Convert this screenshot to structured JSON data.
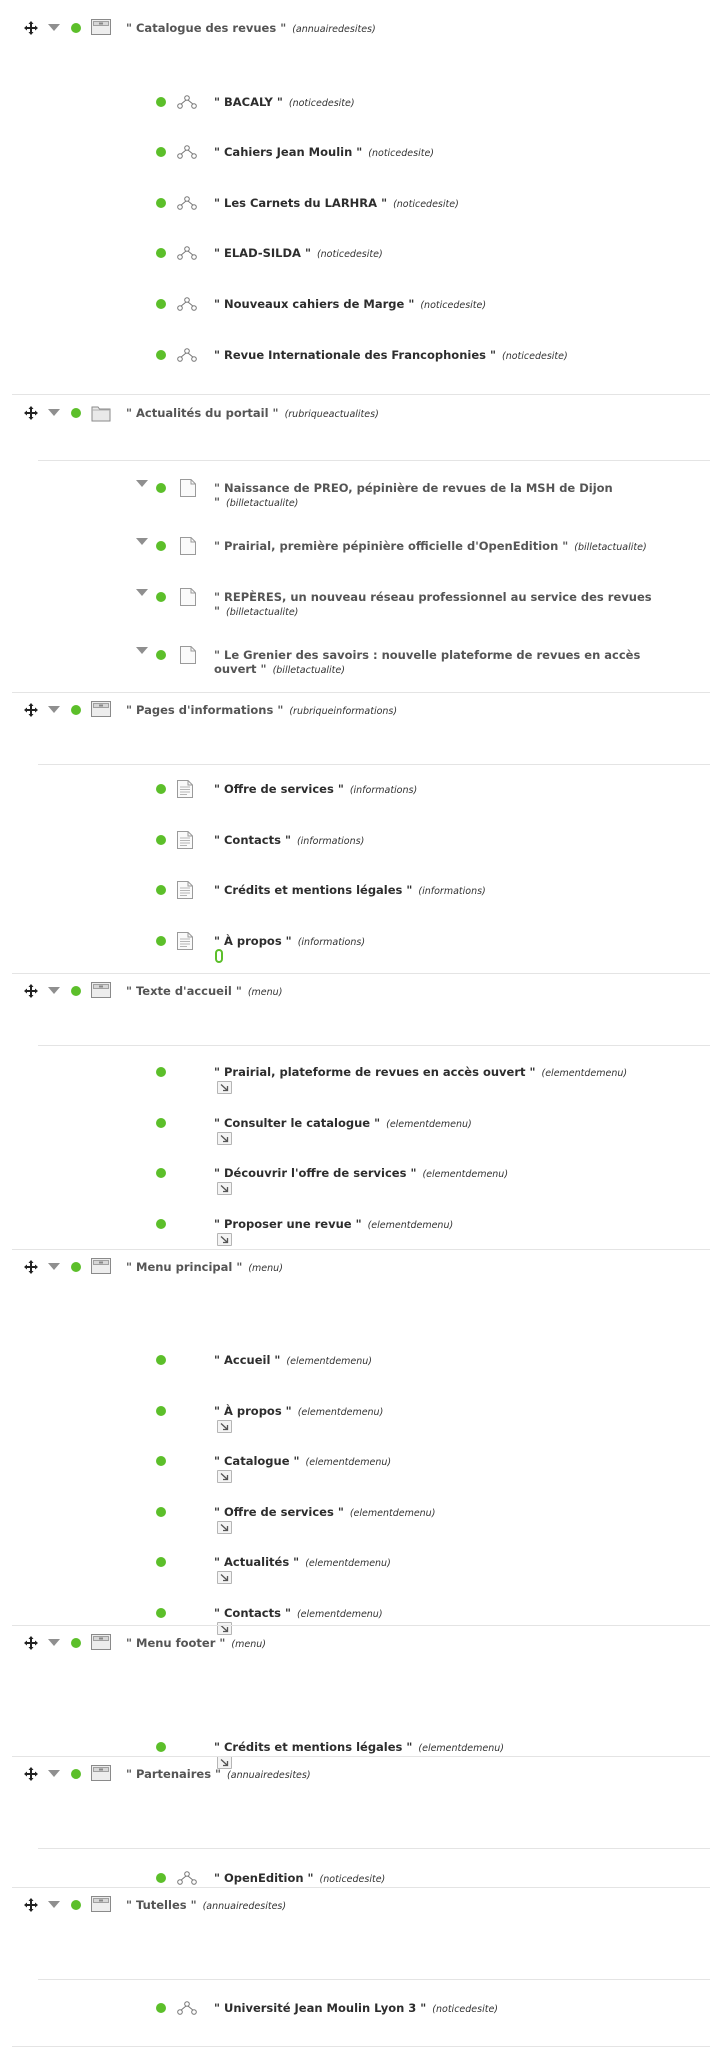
{
  "groups": [
    {
      "title": "\" Catalogue des revues \"",
      "type": "(annuairedesites)",
      "icon": "box-icon",
      "items": [
        {
          "title": "\" BACALY \"",
          "type": "(noticedesite)",
          "icon": "network-icon"
        },
        {
          "title": "\" Cahiers Jean Moulin \"",
          "type": "(noticedesite)",
          "icon": "network-icon"
        },
        {
          "title": "\" Les Carnets du LARHRA \"",
          "type": "(noticedesite)",
          "icon": "network-icon"
        },
        {
          "title": "\" ELAD-SILDA \"",
          "type": "(noticedesite)",
          "icon": "network-icon"
        },
        {
          "title": "\" Nouveaux cahiers de Marge \"",
          "type": "(noticedesite)",
          "icon": "network-icon"
        },
        {
          "title": "\" Revue Internationale des Francophonies \"",
          "type": "(noticedesite)",
          "icon": "network-icon"
        }
      ]
    },
    {
      "title": "\" Actualités du portail \"",
      "type": "(rubriqueactualites)",
      "icon": "folder-icon",
      "items": [
        {
          "title_l1": "\" Naissance de PREO, pépinière de revues de la MSH de Dijon",
          "title_l2": "\"",
          "type": "(billetactualite)",
          "icon": "page-icon"
        },
        {
          "title_l1": "\" Prairial, première pépinière officielle d'OpenEdition \"",
          "title_l2": "",
          "type": "(billetactualite)",
          "icon": "page-icon"
        },
        {
          "title_l1": "\" REPÈRES, un nouveau réseau professionnel au service des revues",
          "title_l2": "\"",
          "type": "(billetactualite)",
          "icon": "page-icon"
        },
        {
          "title_l1": "\" Le Grenier des savoirs : nouvelle plateforme de revues en accès",
          "title_l2": "ouvert \"",
          "type": "(billetactualite)",
          "icon": "page-icon"
        }
      ]
    },
    {
      "title": "\" Pages d'informations \"",
      "type": "(rubriqueinformations)",
      "icon": "box-icon",
      "items": [
        {
          "title": "\" Offre de services \"",
          "type": "(informations)",
          "icon": "document-icon"
        },
        {
          "title": "\" Contacts \"",
          "type": "(informations)",
          "icon": "document-icon"
        },
        {
          "title": "\" Crédits et mentions légales \"",
          "type": "(informations)",
          "icon": "document-icon"
        },
        {
          "title": "\" À propos \"",
          "type": "(informations)",
          "icon": "document-icon"
        }
      ]
    },
    {
      "title": "\" Texte d'accueil \"",
      "type": "(menu)",
      "icon": "box-icon",
      "items": [
        {
          "title": "\" Prairial, plateforme de revues en accès ouvert \"",
          "type": "(elementdemenu)",
          "icon": "external-link-icon"
        },
        {
          "title": "\" Consulter le catalogue \"",
          "type": "(elementdemenu)",
          "icon": "external-link-icon"
        },
        {
          "title": "\" Découvrir l'offre de services \"",
          "type": "(elementdemenu)",
          "icon": "external-link-icon"
        },
        {
          "title": "\" Proposer une revue \"",
          "type": "(elementdemenu)",
          "icon": "external-link-icon"
        }
      ]
    },
    {
      "title": "\" Menu principal \"",
      "type": "(menu)",
      "icon": "box-icon",
      "items": [
        {
          "title": "\" Accueil \"",
          "type": "(elementdemenu)",
          "icon": ""
        },
        {
          "title": "\" À propos \"",
          "type": "(elementdemenu)",
          "icon": "external-link-icon"
        },
        {
          "title": "\" Catalogue \"",
          "type": "(elementdemenu)",
          "icon": "external-link-icon"
        },
        {
          "title": "\" Offre de services \"",
          "type": "(elementdemenu)",
          "icon": "external-link-icon"
        },
        {
          "title": "\" Actualités \"",
          "type": "(elementdemenu)",
          "icon": "external-link-icon"
        },
        {
          "title": "\" Contacts \"",
          "type": "(elementdemenu)",
          "icon": "external-link-icon"
        }
      ]
    },
    {
      "title": "\" Menu footer \"",
      "type": "(menu)",
      "icon": "box-icon",
      "items": [
        {
          "title": "\" Crédits et mentions légales \"",
          "type": "(elementdemenu)",
          "icon": "external-link-icon"
        }
      ]
    },
    {
      "title": "\" Partenaires \"",
      "type": "(annuairedesites)",
      "icon": "box-icon",
      "items": [
        {
          "title": "\" OpenEdition \"",
          "type": "(noticedesite)",
          "icon": "network-icon"
        }
      ]
    },
    {
      "title": "\" Tutelles \"",
      "type": "(annuairedesites)",
      "icon": "box-icon",
      "items": [
        {
          "title": "\" Université Jean Moulin Lyon 3 \"",
          "type": "(noticedesite)",
          "icon": "network-icon"
        }
      ]
    }
  ],
  "colors": {
    "status_published": "#5cbf2a",
    "separator": "#e4e4e4",
    "text_dark": "#2d2d2d"
  }
}
